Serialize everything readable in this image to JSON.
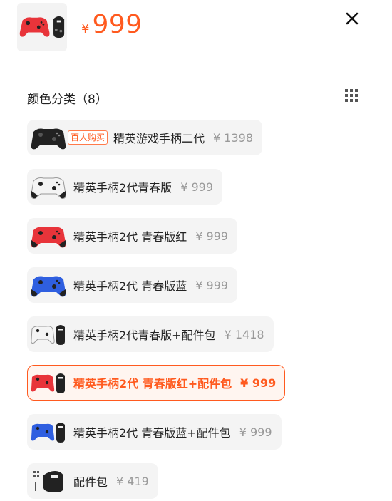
{
  "header": {
    "price_currency": "¥",
    "price_value": "999"
  },
  "section": {
    "title": "颜色分类（8）"
  },
  "variants": [
    {
      "tag": "百人购买",
      "name": "精英游戏手柄二代",
      "price": "¥ 1398",
      "image": "black-controller"
    },
    {
      "name": "精英手柄2代青春版",
      "price": "¥ 999",
      "image": "white-controller"
    },
    {
      "name": "精英手柄2代 青春版红",
      "price": "¥ 999",
      "image": "red-controller"
    },
    {
      "name": "精英手柄2代 青春版蓝",
      "price": "¥ 999",
      "image": "blue-controller"
    },
    {
      "name": "精英手柄2代青春版+配件包",
      "price": "¥ 1418",
      "image": "white-controller-with-case"
    },
    {
      "name": "精英手柄2代 青春版红+配件包",
      "price": "¥ 999",
      "image": "red-controller-with-case",
      "selected": true
    },
    {
      "name": "精英手柄2代 青春版蓝+配件包",
      "price": "¥ 999",
      "image": "blue-controller-with-case"
    },
    {
      "name": "配件包",
      "price": "¥ 419",
      "image": "accessory-case"
    }
  ],
  "colors": {
    "accent": "#ff5a1f",
    "chip_bg": "#f4f4f4",
    "red": "#e8343a",
    "blue": "#2f5fe0",
    "white": "#f2f2f2",
    "black": "#222222"
  }
}
